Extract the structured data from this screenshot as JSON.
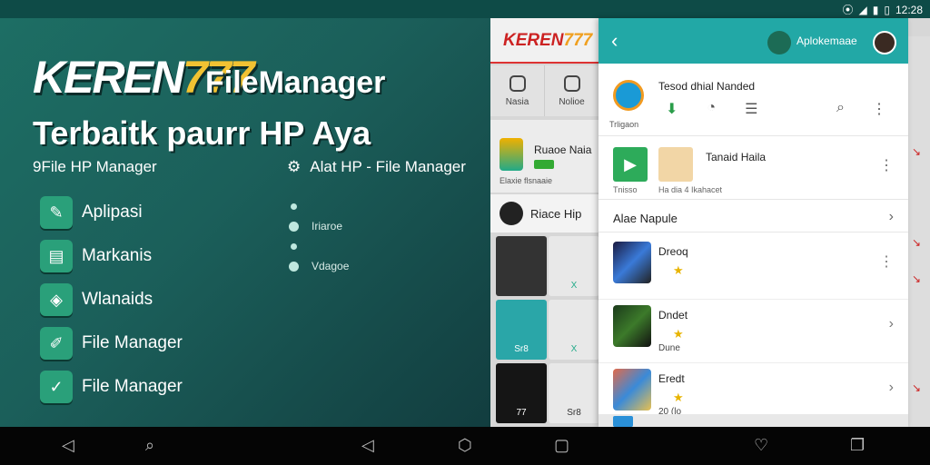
{
  "status": {
    "time": "12:28",
    "icons": [
      "vibrate-icon",
      "wifi-icon",
      "signal-icon",
      "battery-icon"
    ]
  },
  "promo": {
    "brand_text": "KEREN",
    "brand_num": "777",
    "brand_suffix": "FileManager",
    "tagline": "Terbaitk paurr HP Aya",
    "section_heading": "9File HP Manager",
    "menu": [
      {
        "label": "Aplipasi",
        "icon": "apps-icon"
      },
      {
        "label": "Markanis",
        "icon": "monitor-icon"
      },
      {
        "label": "Wlanaids",
        "icon": "shield-icon"
      },
      {
        "label": "File Manager",
        "icon": "folder-edit-icon"
      },
      {
        "label": "File Manager",
        "icon": "check-folder-icon"
      }
    ],
    "right_heading": "Alat HP - File Manager",
    "dot_items": [
      "Iriaroe",
      "Vdagoe"
    ]
  },
  "midapp": {
    "logo_text": "KEREN",
    "logo_num": "777",
    "tabs": [
      "Nasia",
      "Nolioe"
    ],
    "promo_title": "Ruaoe Naia",
    "promo_sub": "Elaxie flsnaaie",
    "user_name": "Riace Hip",
    "grid_caps": [
      "",
      "",
      "Sr8",
      "X",
      "77",
      "Sr8",
      "",
      ""
    ]
  },
  "fm": {
    "title": "Aplokemaae",
    "app_title": "Tesod dhial Nanded",
    "app_caption": "Trligaon",
    "card_title": "Tanaid Haila",
    "card_sub1": "Tnisso",
    "card_sub2": "Ha dia 4 Ikahacet",
    "section_title": "Alae Napule",
    "games": [
      {
        "title": "Dreoq",
        "sub": ""
      },
      {
        "title": "Dndet",
        "sub": "Dune"
      },
      {
        "title": "Eredt",
        "sub": "20 (lo"
      }
    ]
  },
  "colors": {
    "teal": "#22a8a6",
    "promo_bg": "#1b5f5a",
    "accent_gold": "#f1c232"
  }
}
